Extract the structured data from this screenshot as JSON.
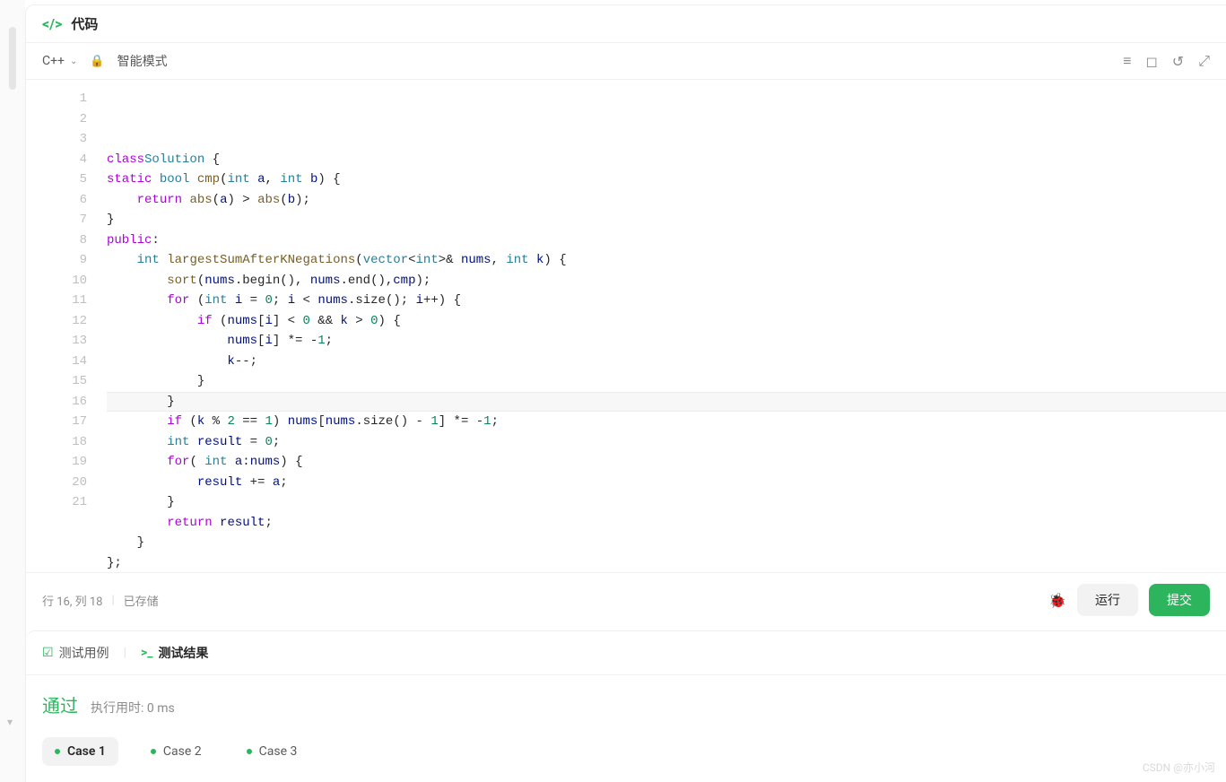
{
  "header": {
    "title": "代码"
  },
  "toolbar": {
    "language": "C++",
    "mode": "智能模式",
    "icons": {
      "lines": "≡",
      "bookmark": "◻",
      "reset": "↺",
      "expand": "⤢"
    }
  },
  "code": {
    "lines": [
      {
        "n": 1,
        "tokens": [
          [
            "kw",
            "class"
          ],
          [
            "",
            ""
          ],
          [
            "cls",
            "Solution"
          ],
          [
            "",
            " {"
          ]
        ]
      },
      {
        "n": 2,
        "tokens": [
          [
            "kw",
            "static"
          ],
          [
            "",
            " "
          ],
          [
            "type",
            "bool"
          ],
          [
            "",
            " "
          ],
          [
            "func",
            "cmp"
          ],
          [
            "",
            "("
          ],
          [
            "type",
            "int"
          ],
          [
            "",
            " "
          ],
          [
            "ident",
            "a"
          ],
          [
            "",
            ", "
          ],
          [
            "type",
            "int"
          ],
          [
            "",
            " "
          ],
          [
            "ident",
            "b"
          ],
          [
            "",
            ") {"
          ]
        ]
      },
      {
        "n": 3,
        "tokens": [
          [
            "",
            "    "
          ],
          [
            "kw",
            "return"
          ],
          [
            "",
            " "
          ],
          [
            "func",
            "abs"
          ],
          [
            "",
            "("
          ],
          [
            "ident",
            "a"
          ],
          [
            "",
            ") > "
          ],
          [
            "func",
            "abs"
          ],
          [
            "",
            "("
          ],
          [
            "ident",
            "b"
          ],
          [
            "",
            ");"
          ]
        ]
      },
      {
        "n": 4,
        "tokens": [
          [
            "",
            "}"
          ]
        ]
      },
      {
        "n": 5,
        "tokens": [
          [
            "kw",
            "public"
          ],
          [
            "",
            ":"
          ]
        ]
      },
      {
        "n": 6,
        "tokens": [
          [
            "",
            "    "
          ],
          [
            "type",
            "int"
          ],
          [
            "",
            " "
          ],
          [
            "func",
            "largestSumAfterKNegations"
          ],
          [
            "",
            "("
          ],
          [
            "cls",
            "vector"
          ],
          [
            "",
            "<"
          ],
          [
            "type",
            "int"
          ],
          [
            "",
            ">& "
          ],
          [
            "ident",
            "nums"
          ],
          [
            "",
            ", "
          ],
          [
            "type",
            "int"
          ],
          [
            "",
            " "
          ],
          [
            "ident",
            "k"
          ],
          [
            "",
            ") {"
          ]
        ]
      },
      {
        "n": 7,
        "tokens": [
          [
            "",
            "        "
          ],
          [
            "func",
            "sort"
          ],
          [
            "",
            "("
          ],
          [
            "ident",
            "nums"
          ],
          [
            "",
            ".begin(), "
          ],
          [
            "ident",
            "nums"
          ],
          [
            "",
            ".end(),"
          ],
          [
            "ident",
            "cmp"
          ],
          [
            "",
            ");"
          ]
        ]
      },
      {
        "n": 8,
        "tokens": [
          [
            "",
            "        "
          ],
          [
            "kw",
            "for"
          ],
          [
            "",
            " ("
          ],
          [
            "type",
            "int"
          ],
          [
            "",
            " "
          ],
          [
            "ident",
            "i"
          ],
          [
            "",
            " = "
          ],
          [
            "num",
            "0"
          ],
          [
            "",
            "; "
          ],
          [
            "ident",
            "i"
          ],
          [
            "",
            " < "
          ],
          [
            "ident",
            "nums"
          ],
          [
            "",
            ".size(); "
          ],
          [
            "ident",
            "i"
          ],
          [
            "",
            "++) {"
          ]
        ]
      },
      {
        "n": 9,
        "tokens": [
          [
            "",
            "            "
          ],
          [
            "kw",
            "if"
          ],
          [
            "",
            " ("
          ],
          [
            "ident",
            "nums"
          ],
          [
            "",
            "["
          ],
          [
            "ident",
            "i"
          ],
          [
            "",
            "] < "
          ],
          [
            "num",
            "0"
          ],
          [
            "",
            " && "
          ],
          [
            "ident",
            "k"
          ],
          [
            "",
            " > "
          ],
          [
            "num",
            "0"
          ],
          [
            "",
            ") {"
          ]
        ]
      },
      {
        "n": 10,
        "tokens": [
          [
            "",
            "                "
          ],
          [
            "ident",
            "nums"
          ],
          [
            "",
            "["
          ],
          [
            "ident",
            "i"
          ],
          [
            "",
            "] *= -"
          ],
          [
            "num",
            "1"
          ],
          [
            "",
            ";"
          ]
        ]
      },
      {
        "n": 11,
        "tokens": [
          [
            "",
            "                "
          ],
          [
            "ident",
            "k"
          ],
          [
            "",
            "--;"
          ]
        ]
      },
      {
        "n": 12,
        "tokens": [
          [
            "",
            "            }"
          ]
        ]
      },
      {
        "n": 13,
        "tokens": [
          [
            "",
            "        }"
          ]
        ]
      },
      {
        "n": 14,
        "tokens": [
          [
            "",
            "        "
          ],
          [
            "kw",
            "if"
          ],
          [
            "",
            " ("
          ],
          [
            "ident",
            "k"
          ],
          [
            "",
            " % "
          ],
          [
            "num",
            "2"
          ],
          [
            "",
            " == "
          ],
          [
            "num",
            "1"
          ],
          [
            "",
            ") "
          ],
          [
            "ident",
            "nums"
          ],
          [
            "",
            "["
          ],
          [
            "ident",
            "nums"
          ],
          [
            "",
            ".size() - "
          ],
          [
            "num",
            "1"
          ],
          [
            "",
            "] *= -"
          ],
          [
            "num",
            "1"
          ],
          [
            "",
            ";"
          ]
        ]
      },
      {
        "n": 15,
        "tokens": [
          [
            "",
            "        "
          ],
          [
            "type",
            "int"
          ],
          [
            "",
            " "
          ],
          [
            "ident",
            "result"
          ],
          [
            "",
            " = "
          ],
          [
            "num",
            "0"
          ],
          [
            "",
            ";"
          ]
        ]
      },
      {
        "n": 16,
        "tokens": [
          [
            "",
            "        "
          ],
          [
            "kw",
            "for"
          ],
          [
            "",
            "( "
          ],
          [
            "type",
            "int"
          ],
          [
            "",
            " "
          ],
          [
            "ident",
            "a"
          ],
          [
            "",
            ":"
          ],
          [
            "ident",
            "nums"
          ],
          [
            "",
            ") {"
          ]
        ]
      },
      {
        "n": 17,
        "tokens": [
          [
            "",
            "            "
          ],
          [
            "ident",
            "result"
          ],
          [
            "",
            " += "
          ],
          [
            "ident",
            "a"
          ],
          [
            "",
            ";"
          ]
        ]
      },
      {
        "n": 18,
        "tokens": [
          [
            "",
            "        }"
          ]
        ]
      },
      {
        "n": 19,
        "tokens": [
          [
            "",
            "        "
          ],
          [
            "kw",
            "return"
          ],
          [
            "",
            " "
          ],
          [
            "ident",
            "result"
          ],
          [
            "",
            ";"
          ]
        ]
      },
      {
        "n": 20,
        "tokens": [
          [
            "",
            "    }"
          ]
        ]
      },
      {
        "n": 21,
        "tokens": [
          [
            "",
            "};"
          ]
        ]
      }
    ],
    "highlighted_line": 16
  },
  "status": {
    "position": "行 16,  列 18",
    "saved": "已存储",
    "run_label": "运行",
    "submit_label": "提交"
  },
  "results": {
    "tab_testcases": "测试用例",
    "tab_results": "测试结果",
    "pass": "通过",
    "runtime": "执行用时: 0 ms",
    "cases": [
      "Case 1",
      "Case 2",
      "Case 3"
    ]
  },
  "watermark": "CSDN @亦小河"
}
